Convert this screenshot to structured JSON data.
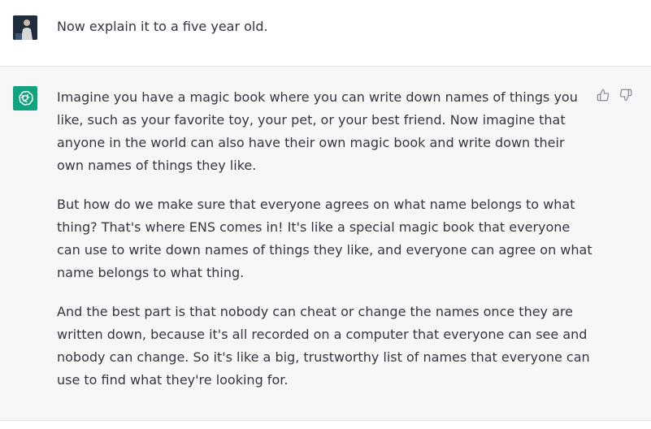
{
  "user_message": {
    "text": "Now explain it to a five year old."
  },
  "assistant_message": {
    "paragraphs": [
      "Imagine you have a magic book where you can write down names of things you like, such as your favorite toy, your pet, or your best friend. Now imagine that anyone in the world can also have their own magic book and write down their own names of things they like.",
      "But how do we make sure that everyone agrees on what name belongs to what thing? That's where ENS comes in! It's like a special magic book that everyone can use to write down names of things they like, and everyone can agree on what name belongs to what thing.",
      "And the best part is that nobody can cheat or change the names once they are written down, because it's all recorded on a computer that everyone can see and nobody can change. So it's like a big, trustworthy list of names that everyone can use to find what they're looking for."
    ]
  },
  "colors": {
    "assistant_logo_bg": "#10a37f",
    "assistant_row_bg": "#f7f7f8",
    "text": "#343541"
  },
  "icons": {
    "thumbs_up": "thumbs-up-icon",
    "thumbs_down": "thumbs-down-icon",
    "logo": "openai-logo-icon"
  }
}
